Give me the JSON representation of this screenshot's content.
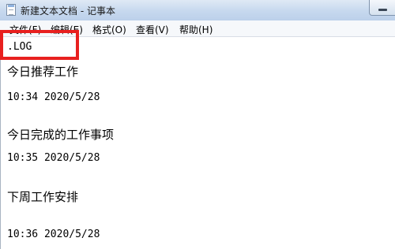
{
  "window": {
    "title": "新建文本文档 - 记事本",
    "icon": "notepad-icon"
  },
  "menu": {
    "items": [
      {
        "label": "文件(F)"
      },
      {
        "label": "编辑(E)"
      },
      {
        "label": "格式(O)"
      },
      {
        "label": "查看(V)"
      },
      {
        "label": "帮助(H)"
      }
    ]
  },
  "editor": {
    "lines": [
      ".LOG",
      "今日推荐工作",
      "10:34 2020/5/28",
      "今日完成的工作事项",
      "10:35 2020/5/28",
      "下周工作安排",
      "10:36 2020/5/28"
    ]
  },
  "annotation": {
    "color": "#e8201f"
  }
}
